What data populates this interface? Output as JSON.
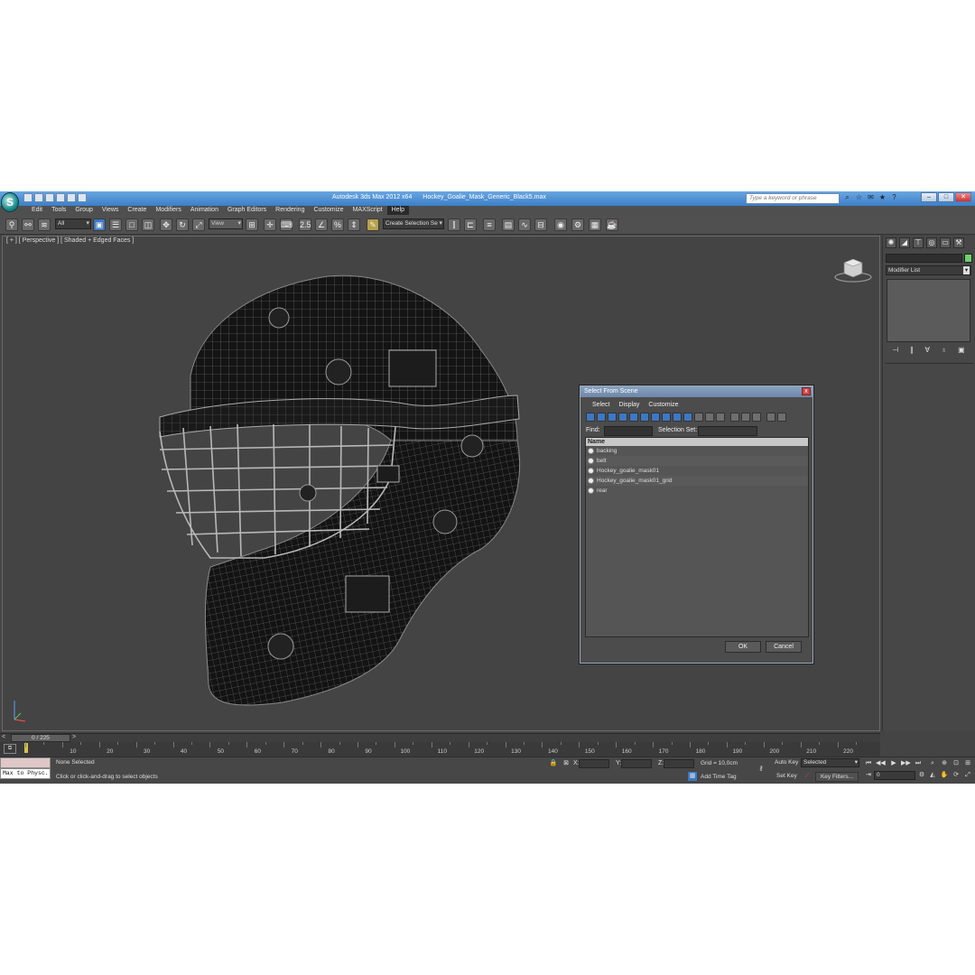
{
  "titlebar": {
    "app": "Autodesk 3ds Max  2012 x64",
    "file": "Hockey_Goalie_Mask_Generic_Black5.max",
    "search_placeholder": "Type a keyword or phrase"
  },
  "menus": [
    "Edit",
    "Tools",
    "Group",
    "Views",
    "Create",
    "Modifiers",
    "Animation",
    "Graph Editors",
    "Rendering",
    "Customize",
    "MAXScript",
    "Help"
  ],
  "toolbar": {
    "selection_filter": "All",
    "ref_coord": "View",
    "snap_label": "2.5",
    "named_sel_placeholder": "Create Selection Se"
  },
  "viewport": {
    "label": "[ + ] [ Perspective ] [ Shaded + Edged Faces ]",
    "viewcube_label": "FRONT"
  },
  "dialog": {
    "title": "Select From Scene",
    "close": "x",
    "menu": [
      "Select",
      "Display",
      "Customize"
    ],
    "find_label": "Find:",
    "selection_set_label": "Selection Set:",
    "column_name": "Name",
    "items": [
      "backing",
      "belt",
      "Hockey_goalie_mask01",
      "Hockey_goalie_mask01_grid",
      "rear"
    ],
    "ok": "OK",
    "cancel": "Cancel"
  },
  "command_panel": {
    "modifier_list": "Modifier List",
    "object_color": "#6dd26d"
  },
  "timeline": {
    "left_arrow": "<",
    "right_arrow": ">",
    "frame_display": "0 / 225",
    "ticks": [
      "10",
      "20",
      "30",
      "40",
      "50",
      "60",
      "70",
      "80",
      "90",
      "100",
      "110",
      "120",
      "130",
      "140",
      "150",
      "160",
      "170",
      "180",
      "190",
      "200",
      "210",
      "220"
    ]
  },
  "status": {
    "maxscript_text": "Max to Physc.",
    "selected": "None Selected",
    "prompt": "Click or click-and-drag to select objects",
    "x_label": "X:",
    "y_label": "Y:",
    "z_label": "Z:",
    "grid": "Grid = 10,0cm",
    "add_time_tag": "Add Time Tag",
    "auto_key": "Auto Key",
    "set_key": "Set Key",
    "selected_dropdown": "Selected",
    "key_filters": "Key Filters...",
    "frame": "0"
  },
  "colors": {
    "titlebar": "#3b7fc8",
    "viewport_bg": "#444444",
    "accent_blue": "#3d78c4"
  }
}
